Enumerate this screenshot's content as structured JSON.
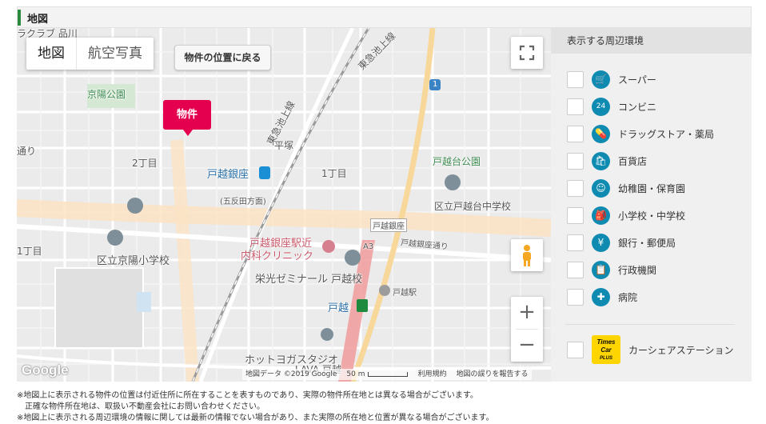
{
  "section": {
    "title": "地図"
  },
  "map": {
    "type_tabs": [
      "地図",
      "航空写真"
    ],
    "return_button": "物件の位置に戻る",
    "property_marker": "物件",
    "labels": {
      "top_cut": "ラクラブ 品川",
      "keiyo_park": "京陽公園",
      "line_tokyu_top": "東急池上線",
      "line_tokyu_mid": "東急池上線",
      "route1": "1",
      "chome2": "2丁目",
      "hiratsuka": "平塚",
      "chome1a": "1丁目",
      "chome1b": "1丁目",
      "togoshi_ginza_st": "戸越銀座",
      "gotanda_dir": "(五反田方面)",
      "togoshidai_park": "戸越台公園",
      "school_togoshidai": "区立戸越台中学校",
      "togoshi_ginza_street_sign": "戸越銀座",
      "togoshi_ginza_dori": "戸越銀座通り",
      "clinic_1": "戸越銀座駅近",
      "clinic_2": "内科クリニック",
      "school_keiyo": "区立京陽小学校",
      "a3": "A3",
      "seminar": "栄光ゼミナール 戸越校",
      "togoshi_station": "戸越駅",
      "togoshi": "戸越",
      "hot_yoga": "ホットヨガスタジオ",
      "hot_yoga_2": "LAVA 戸越",
      "left_cut": "通り"
    },
    "attribution": {
      "data": "地図データ ©2019 Google",
      "scale": "50 m",
      "terms": "利用規約",
      "report": "地図の誤りを報告する"
    },
    "logo": "Google",
    "zoom_in": "+",
    "zoom_out": "−"
  },
  "sidebar": {
    "title": "表示する周辺環境",
    "items": [
      {
        "label": "スーパー",
        "icon": "cart-icon",
        "glyph": "🛒"
      },
      {
        "label": "コンビニ",
        "icon": "convenience-store-icon",
        "glyph": "24"
      },
      {
        "label": "ドラッグストア・薬局",
        "icon": "pill-icon",
        "glyph": "💊"
      },
      {
        "label": "百貨店",
        "icon": "department-store-icon",
        "glyph": "🛍"
      },
      {
        "label": "幼稚園・保育園",
        "icon": "kindergarten-icon",
        "glyph": "☺"
      },
      {
        "label": "小学校・中学校",
        "icon": "school-icon",
        "glyph": "🎒"
      },
      {
        "label": "銀行・郵便局",
        "icon": "bank-icon",
        "glyph": "¥"
      },
      {
        "label": "行政機関",
        "icon": "government-icon",
        "glyph": "📋"
      },
      {
        "label": "病院",
        "icon": "hospital-icon",
        "glyph": "✚"
      }
    ],
    "car_share": {
      "label": "カーシェアステーション",
      "logo_top": "Times",
      "logo_mid": "Car",
      "logo_bot": "PLUS"
    }
  },
  "notes": [
    "※地図上に表示される物件の位置は付近住所に所在することを表すものであり、実際の物件所在地とは異なる場合がございます。",
    "　正確な物件所在地は、取扱い不動産会社にお問い合わせください。",
    "※地図上に表示される周辺環境の情報に関しては最新の情報でない場合があり、また実際の所在地と位置が異なる場合がございます。"
  ],
  "colors": {
    "accent_green": "#2b8a3e",
    "marker_pink": "#e4004f",
    "icon_blue": "#0f8bb2",
    "rail_red": "#f0a0a0"
  }
}
